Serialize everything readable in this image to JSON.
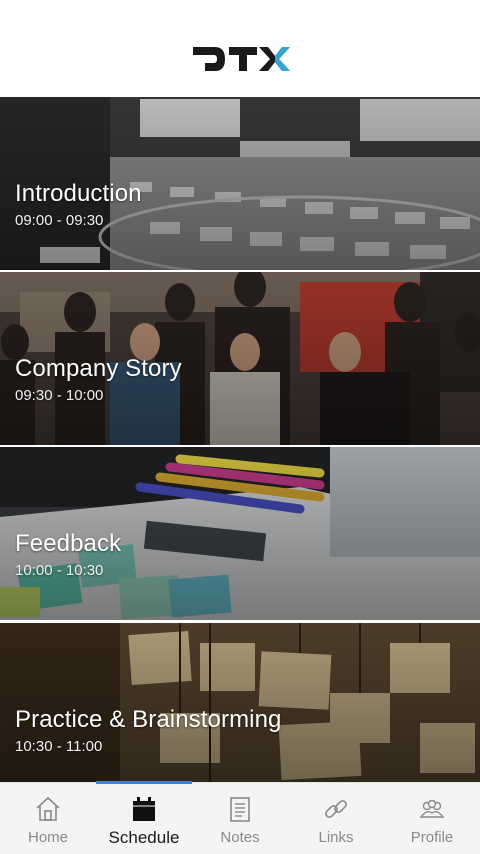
{
  "header": {
    "logo_text": "DTX"
  },
  "sessions": [
    {
      "title": "Introduction",
      "time": "09:00 - 09:30"
    },
    {
      "title": "Company Story",
      "time": "09:30 - 10:00"
    },
    {
      "title": "Feedback",
      "time": "10:00 - 10:30"
    },
    {
      "title": "Practice & Brainstorming",
      "time": "10:30 - 11:00"
    }
  ],
  "tabbar": {
    "active": "Schedule",
    "tabs": [
      {
        "label": "Home",
        "icon": "home-icon"
      },
      {
        "label": "Schedule",
        "icon": "calendar-icon"
      },
      {
        "label": "Notes",
        "icon": "notes-icon"
      },
      {
        "label": "Links",
        "icon": "link-icon"
      },
      {
        "label": "Profile",
        "icon": "people-icon"
      }
    ]
  },
  "colors": {
    "accent": "#3d86d6",
    "logo_dark": "#1a1a1a",
    "logo_accent": "#2fa8d8"
  }
}
